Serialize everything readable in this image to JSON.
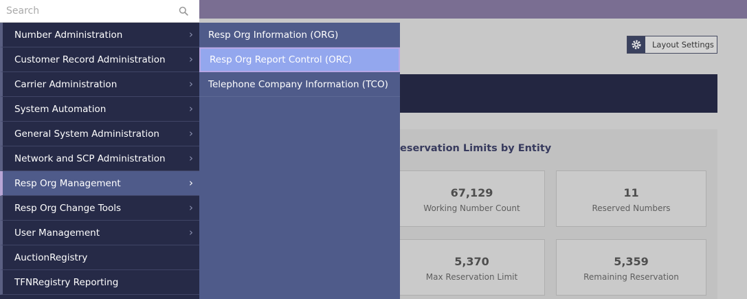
{
  "search": {
    "placeholder": "Search"
  },
  "menu": {
    "items": [
      {
        "label": "Number Administration",
        "has_submenu": true
      },
      {
        "label": "Customer Record Administration",
        "has_submenu": true
      },
      {
        "label": "Carrier Administration",
        "has_submenu": true
      },
      {
        "label": "System Automation",
        "has_submenu": true
      },
      {
        "label": "General System Administration",
        "has_submenu": true
      },
      {
        "label": "Network and SCP Administration",
        "has_submenu": true
      },
      {
        "label": "Resp Org Management",
        "has_submenu": true,
        "active": true
      },
      {
        "label": "Resp Org Change Tools",
        "has_submenu": true
      },
      {
        "label": "User Management",
        "has_submenu": true
      },
      {
        "label": "AuctionRegistry",
        "has_submenu": false
      },
      {
        "label": "TFNRegistry Reporting",
        "has_submenu": false
      }
    ]
  },
  "submenu": {
    "items": [
      {
        "label": "Resp Org Information (ORG)"
      },
      {
        "label": "Resp Org Report Control (ORC)",
        "highlighted": true
      },
      {
        "label": "Telephone Company Information (TCO)"
      }
    ]
  },
  "page": {
    "layout_settings_label": "Layout Settings",
    "panel_title": "eservation Limits by Entity",
    "cards": [
      {
        "value": "67,129",
        "caption": "Working Number Count"
      },
      {
        "value": "11",
        "caption": "Reserved Numbers"
      },
      {
        "value": "5,370",
        "caption": "Max Reservation Limit"
      },
      {
        "value": "5,359",
        "caption": "Remaining Reservation"
      }
    ]
  },
  "icons": {
    "search": "search-icon",
    "gear": "gear-icon",
    "chevron": "chevron-right-icon"
  },
  "colors": {
    "topbar": "#85789f",
    "menu_bg": "#262a47",
    "submenu_bg": "#4f5b8a",
    "highlight": "#93a7ee"
  }
}
